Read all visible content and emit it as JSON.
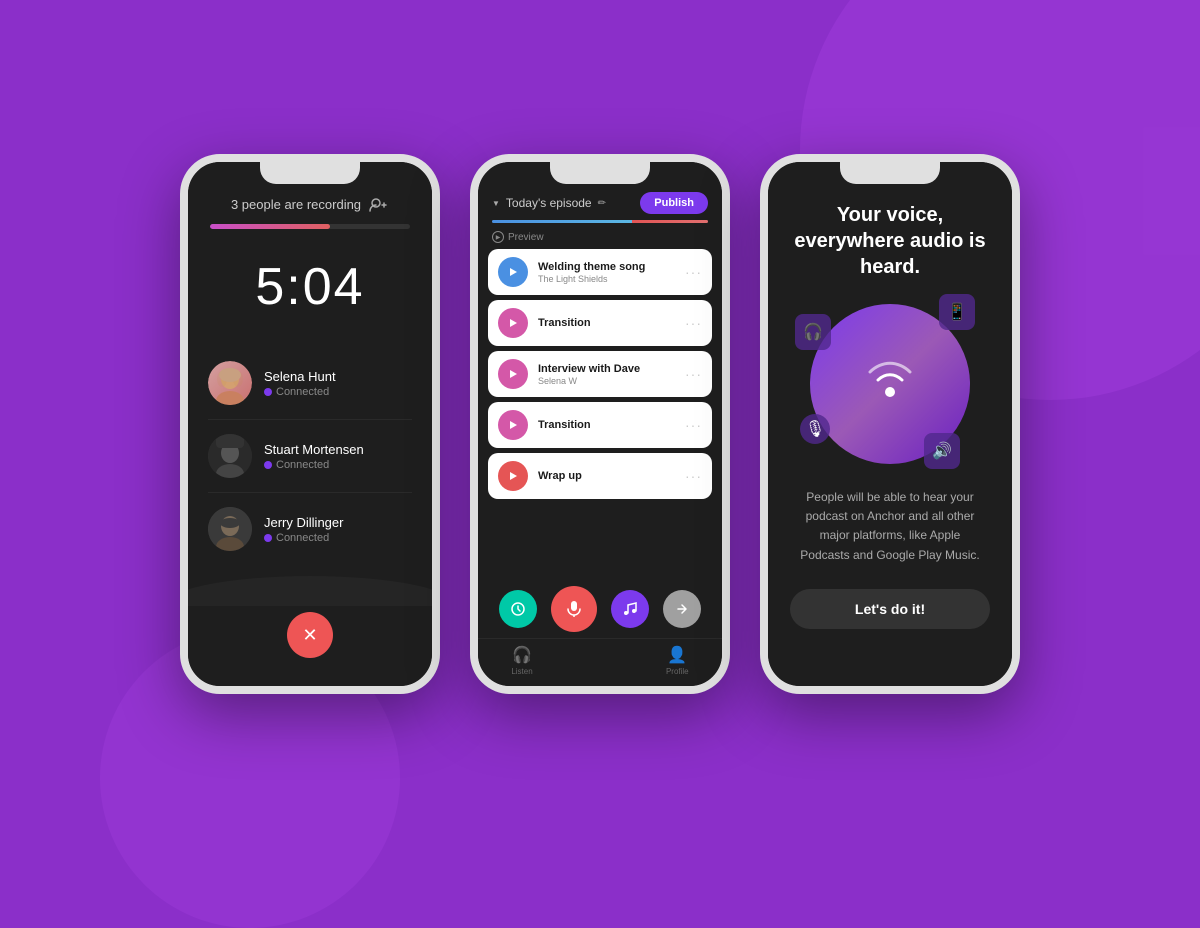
{
  "background": {
    "color": "#8B2FC9"
  },
  "phone1": {
    "recording_title": "3 people are recording",
    "timer": "5:04",
    "participants": [
      {
        "name": "Selena Hunt",
        "status": "Connected"
      },
      {
        "name": "Stuart Mortensen",
        "status": "Connected"
      },
      {
        "name": "Jerry Dillinger",
        "status": "Connected"
      }
    ],
    "end_call_icon": "✕",
    "progress": 60
  },
  "phone2": {
    "episode_label": "Today's episode",
    "publish_label": "Publish",
    "preview_label": "Preview",
    "tracks": [
      {
        "name": "Welding theme song",
        "subtitle": "The Light Shields",
        "color": "blue"
      },
      {
        "name": "Transition",
        "subtitle": "",
        "color": "pink"
      },
      {
        "name": "Interview with Dave",
        "subtitle": "Selena W",
        "color": "pink"
      },
      {
        "name": "Transition",
        "subtitle": "",
        "color": "pink"
      },
      {
        "name": "Wrap up",
        "subtitle": "",
        "color": "red"
      }
    ],
    "nav": [
      {
        "label": "Listen",
        "icon": "🎧"
      },
      {
        "label": "",
        "icon": "🎙"
      },
      {
        "label": "Profile",
        "icon": "👤"
      }
    ]
  },
  "phone3": {
    "tagline": "Your voice, everywhere audio is heard.",
    "description": "People will be able to hear your podcast on Anchor and all other major platforms, like Apple Podcasts and Google Play Music.",
    "cta_label": "Let's do it!"
  }
}
